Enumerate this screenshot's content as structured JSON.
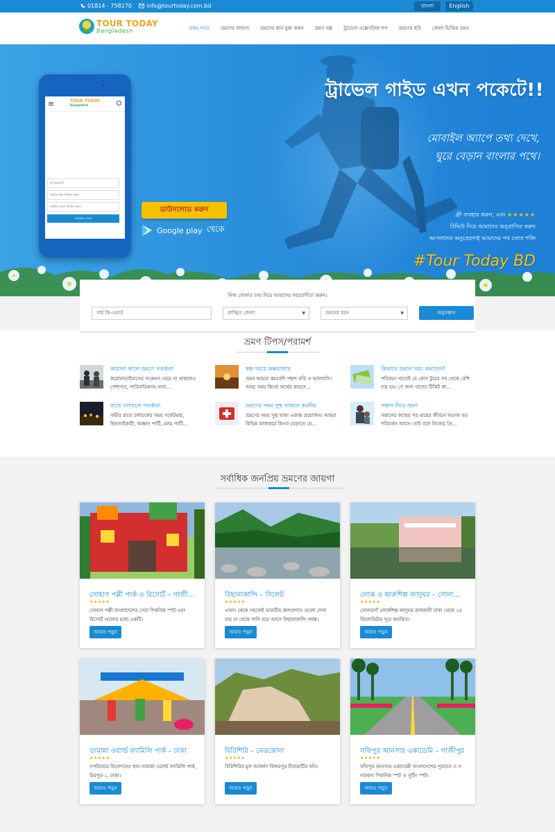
{
  "topbar": {
    "phone": "01814 - 758170",
    "email": "info@tourtoday.com.bd",
    "lang_bn": "বাংলা",
    "lang_en": "English"
  },
  "logo": {
    "line1": "TOUR TODAY",
    "line2": "Bangladesh"
  },
  "menu": [
    {
      "label": "প্রথম পাতা",
      "active": true
    },
    {
      "label": "ভ্রমণের জায়গা"
    },
    {
      "label": "ভ্রমণের স্থান যুক্ত করুন"
    },
    {
      "label": "ভ্রমণ গল্প"
    },
    {
      "label": "ট্রাভেল এক্সেসরিজ শপ"
    },
    {
      "label": "ভ্রমণের ছবি"
    },
    {
      "label": "জেলা ভিত্তিক ভ্রমন"
    }
  ],
  "hero": {
    "headline": "ট্রাভেল গাইড এখন পকেটে!!",
    "sub1": "মোবাইল অ্যাপে তথ্য দেখে,",
    "sub2": "ঘুরে বেড়ান বাংলার পথে।",
    "download": "ডাউনলোড করুন",
    "gplay": "Google play",
    "gplay_suffix": "থেকে",
    "tag1": "ফ্রী ব্যবহার করুন, এবং",
    "stars": "★★★★★",
    "tag2": "রিভিউ দিয়ে আমাদের অনুপ্রাণিত করুন",
    "tag3": "আপনাদের অনুপ্রেরণাই আমাদের পথ চলার শক্তি",
    "hashtag": "#Tour Today BD",
    "phone_app": {
      "logo1": "TOUR TODAY",
      "logo2": "Bangladesh",
      "field1": "কি খুজছেন?",
      "field2": "ভ্রমণের ধরন নির্বাচন করুন",
      "field3": "কাঙ্খিত জেলা নির্বাচন করুন",
      "button": "অনুসন্ধান করুন"
    }
  },
  "search": {
    "prompt": "নিজ জেলার তথ্য দিয়ে আমাদের সহযোগীতা করুন।",
    "keyword_placeholder": "সার্চ কি-ওয়ার্ড",
    "district": "কাঙ্খিত জেলা",
    "type": "ভ্রমনের ধরন",
    "button": "অনুসন্ধান"
  },
  "tips": {
    "title": "ভ্রমণ টিপস/পরামর্শ",
    "items": [
      {
        "title": "করোনা কালে ভ্রমণে সতর্কতা",
        "desc": "করোনাভাইরাসের সংক্রমণ থেমে না থাকলেও পেশাগত, পারিবারিকসহ নানা…",
        "thumb": "people"
      },
      {
        "title": "স্বল্প খরচে কক্সবাজার",
        "desc": "ভ্রমন আমরা কমবেশি পছন্দ করি ও ভালবাসি। অথচ সময় কিংবা অর্থের কারনে…",
        "thumb": "sunset"
      },
      {
        "title": "কিভাবে ভ্রমনে খরচ কমাবেন?",
        "desc": "পরিবহন খাতেই যে কোন টুরের সব থেকে বেশি ব্যয় হয়। সে জন্য বাসের টিকিট কা…",
        "thumb": "money"
      },
      {
        "title": "রাতে চলাচলে সতর্কতা",
        "desc": "গভীর রাতে চলাচলের সময় পকেটমার, ছিনতাইকারী, অজ্ঞান পার্টি, মলম পার্টি…",
        "thumb": "night"
      },
      {
        "title": "ভ্রমণের সময় সুস্থ থাকতে করনীয়",
        "desc": "ভ্রমণের সময় সুস্থ থাকা একান্ত প্রয়োজন। আমরা বিভিন্ন কাজকর্মে কিংবা বেড়াতে যে…",
        "thumb": "firstaid"
      },
      {
        "title": "সন্তান নিয়ে ভ্রমণ",
        "desc": "সন্তানের জন্মের পর মায়ের জীবনে অনেক বড় পরিবর্তন আসে। তাই বলে নিজের প্রি…",
        "thumb": "family"
      }
    ]
  },
  "popular": {
    "title": "সর্বাধিক জনপ্রিয় ভ্রমণের জায়গা",
    "more_label": "আরও পড়ুন",
    "rating": "★★★★★",
    "cards": [
      {
        "title": "সোহাগ পল্লী পার্ক ও রিসোর্ট – গাজী…",
        "desc": "সোহাগ পল্লী বাংলাদেশের সেরা পিকনিক স্পট এবং রিসোর্ট গুলোর মধ্যে একটি।",
        "scene": "park"
      },
      {
        "title": "বিছানাকান্দি – সিলেট",
        "desc": "এখান থেকে সহজেই ভারতীয় জলপ্রপাত গুলো দেখা যায় যা থেকে পানি বয়ে আসে বিছানাকান্দি পর্যন্ত।",
        "scene": "river"
      },
      {
        "title": "লোক ও কারুশিল্প জাদুঘর – সোনা…",
        "desc": "সোনারগাঁ লোকশিল্প জাদুঘর রাজধানী ঢাকা থেকে ২৪ কিলোমিটার দূরে অবস্থিত।",
        "scene": "museum"
      },
      {
        "title": "তামান্না ওয়ার্ল্ড ফ্যামিলি পার্ক – ঢাকা",
        "desc": "সপরিবারে বিনোদনের স্থান তামান্না ওয়ার্ল্ড ফ্যামিলি পার্ক, মিরপুর-১, ঢাকা।",
        "scene": "amuse"
      },
      {
        "title": "বিরিশিরি – নেত্রকোনা",
        "desc": "বিরিশিরির মূল আকর্ষণ বিজয়পুর চীনামাটির খনি।",
        "scene": "hill"
      },
      {
        "title": "সফিপুর আনসার একাডেমি – গাজীপুর",
        "desc": "সফিপুর আনসার একাডেমী বাংলাদেশের পুরাতন ও স নামধন্য পিকনিক স্পট ও সুটিং স্পট।",
        "scene": "road"
      }
    ]
  }
}
